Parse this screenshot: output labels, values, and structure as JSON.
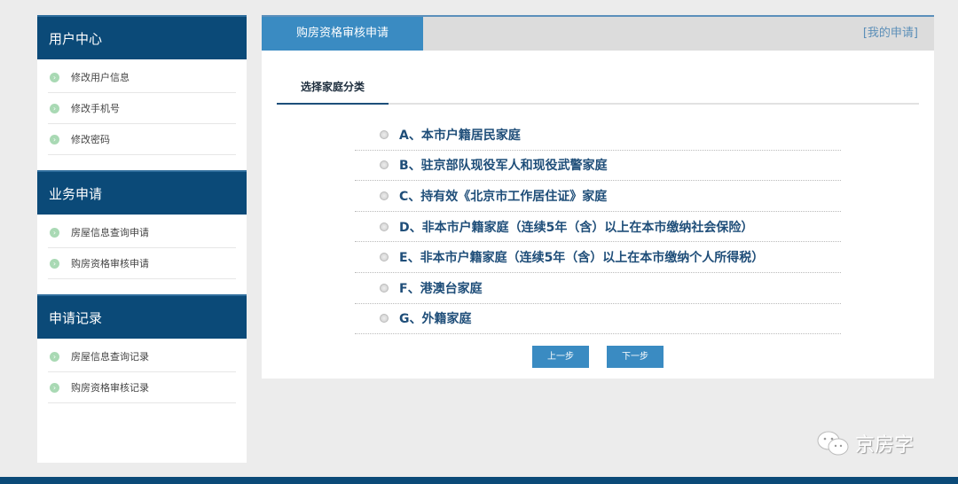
{
  "sidebar": [
    {
      "title": "用户中心",
      "items": [
        "修改用户信息",
        "修改手机号",
        "修改密码"
      ]
    },
    {
      "title": "业务申请",
      "items": [
        "房屋信息查询申请",
        "购房资格审核申请"
      ]
    },
    {
      "title": "申请记录",
      "items": [
        "房屋信息查询记录",
        "购房资格审核记录"
      ]
    }
  ],
  "main": {
    "tab": "购房资格审核申请",
    "my_link": "[我的申请]",
    "subtab": "选择家庭分类",
    "options": [
      "A、本市户籍居民家庭",
      "B、驻京部队现役军人和现役武警家庭",
      "C、持有效《北京市工作居住证》家庭",
      "D、非本市户籍家庭（连续5年（含）以上在本市缴纳社会保险）",
      "E、非本市户籍家庭（连续5年（含）以上在本市缴纳个人所得税）",
      "F、港澳台家庭",
      "G、外籍家庭"
    ],
    "prev": "上一步",
    "next": "下一步"
  },
  "watermark": "京房字"
}
